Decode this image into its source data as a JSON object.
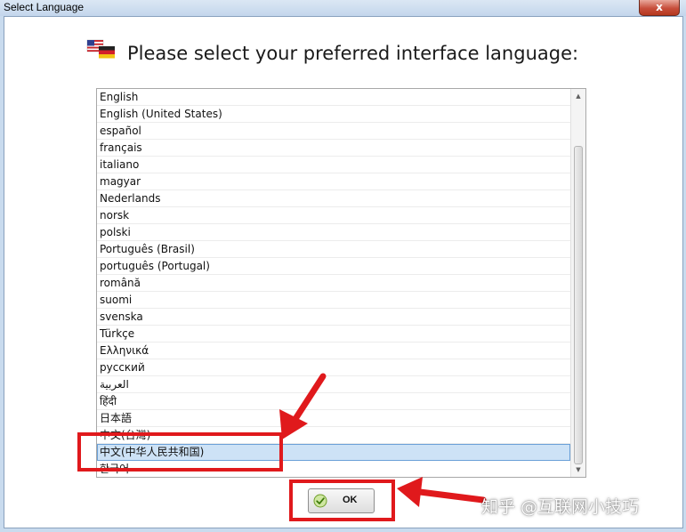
{
  "window": {
    "title": "Select Language",
    "close_glyph": "x"
  },
  "dialog": {
    "heading": "Please select your preferred interface language:",
    "flag_icon": "flags-us-de-icon"
  },
  "languages": [
    "English",
    "English (United States)",
    "español",
    "français",
    "italiano",
    "magyar",
    "Nederlands",
    "norsk",
    "polski",
    "Português (Brasil)",
    "português (Portugal)",
    "română",
    "suomi",
    "svenska",
    "Türkçe",
    "Ελληνικά",
    "русский",
    "العربية",
    "हिंदी",
    "日本語",
    "中文(台灣)",
    "中文(中华人民共和国)",
    "한국어"
  ],
  "selected_language": "中文(中华人民共和国)",
  "ok_button": {
    "label": "OK",
    "icon": "check-circle-icon"
  },
  "watermark": "知乎 @互联网小技巧",
  "colors": {
    "annotation": "#e0191c",
    "selection": "#cde2f6"
  }
}
